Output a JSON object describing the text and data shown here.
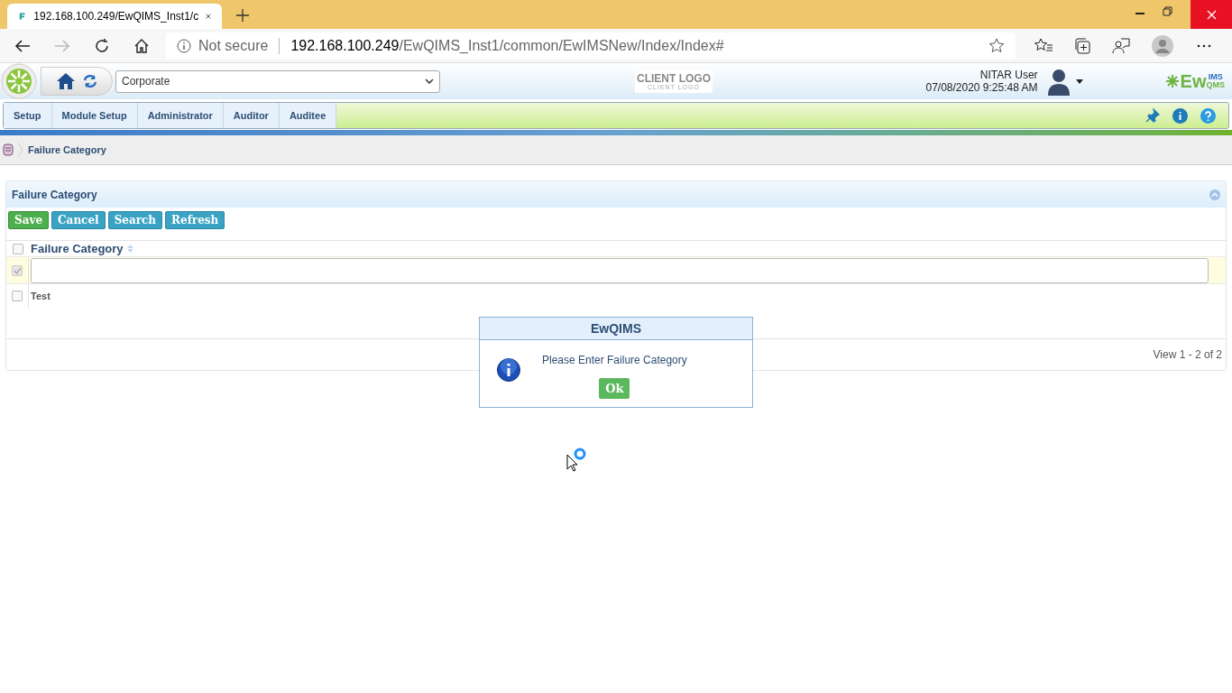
{
  "browser": {
    "tab_title": "192.168.100.249/EwQIMS_Inst1/c",
    "security": "Not secure",
    "url_host": "192.168.100.249",
    "url_path": "/EwQIMS_Inst1/common/EwIMSNew/Index/Index#"
  },
  "header": {
    "site": "Corporate",
    "client_logo": "CLIENT LOGO",
    "client_logo_sub": "CLIENT LOGO",
    "user": "NITAR User",
    "datetime": "07/08/2020 9:25:48 AM",
    "brand": "Ew",
    "brand_top": "IMS",
    "brand_bottom": "QMS"
  },
  "menu": [
    {
      "label": "Setup",
      "selected": false
    },
    {
      "label": "Module Setup",
      "selected": false
    },
    {
      "label": "Administrator",
      "selected": false
    },
    {
      "label": "Auditor",
      "selected": false
    },
    {
      "label": "Auditee",
      "selected": false
    }
  ],
  "breadcrumb": "Failure Category",
  "panel": {
    "title": "Failure Category",
    "buttons": [
      {
        "label": "Save",
        "kind": "primary"
      },
      {
        "label": "Cancel",
        "kind": "secondary"
      },
      {
        "label": "Search",
        "kind": "secondary"
      },
      {
        "label": "Refresh",
        "kind": "secondary"
      }
    ],
    "column": "Failure Category",
    "select_all_checked": false,
    "rows": [
      {
        "kind": "edit",
        "checked": true,
        "disabled": true
      },
      {
        "kind": "text",
        "value": "Test",
        "checked": false,
        "disabled": false
      }
    ],
    "pager": "View 1 - 2 of 2"
  },
  "dialog": {
    "title": "EwQIMS",
    "message": "Please Enter Failure Category",
    "button": "Ok"
  }
}
